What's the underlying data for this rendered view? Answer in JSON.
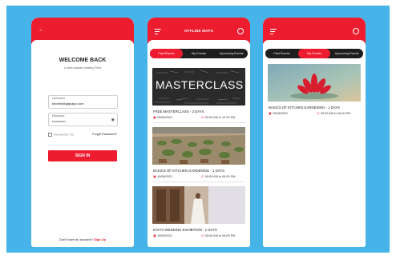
{
  "colors": {
    "brand_red": "#ed1c2e",
    "background_blue": "#46b4e8",
    "tab_dark": "#1e1e1e"
  },
  "login": {
    "back_icon": "arrow-left-icon",
    "welcome": "WELCOME BACK",
    "subtitle": "Lorem ipsum dummy Text",
    "username_label": "Username",
    "username_value": "shobile@gigsapp.com",
    "password_label": "Password",
    "password_value": "••••••••••••",
    "remember_label": "Remember me",
    "forgot_label": "Forgot Password?",
    "signin_label": "SIGN IN",
    "no_account": "Don't have an account?",
    "signup_label": "Sign Up"
  },
  "events": {
    "title": "OFFLINE MAPS",
    "tabs": [
      "Past Events",
      "My Events",
      "Upcoming Events"
    ],
    "cards": [
      {
        "title": "FREE MASTERCLASS - 3 DAYS",
        "date": "25/08/2021",
        "time": "09:00 AM to 12:00 PM",
        "image_text": "MASTERCLASS"
      },
      {
        "title": "BASICS OF KITCHEN GARDENING - 1 DAYS",
        "date": "19/08/2021",
        "time": "09:00 AM to 06:00 PM"
      },
      {
        "title": "KAVYA WEDDING EXHIBITION - 1 DAYS",
        "date": "19/08/2021",
        "time": "09:00 AM to 06:00 PM"
      }
    ]
  },
  "my_events": {
    "tabs": [
      "Past Events",
      "My Events",
      "Upcoming Events"
    ],
    "cards": [
      {
        "title": "BASICS OF KITCHEN GARDENING - 1 DAYS",
        "date": "25/08/2021",
        "time": "09:00 AM to 06:00 PM"
      }
    ]
  }
}
